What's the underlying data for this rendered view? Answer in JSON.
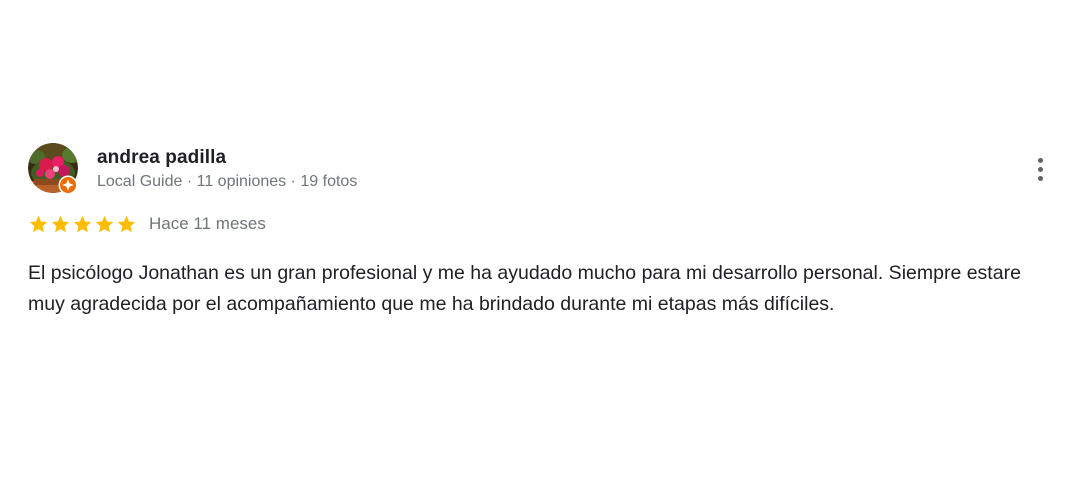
{
  "review": {
    "reviewer": {
      "name": "andrea padilla",
      "meta": "Local Guide · 11 opiniones · 19 fotos",
      "avatar_icon": "profile-photo-flowers",
      "badge_icon": "local-guide-badge-icon"
    },
    "rating": {
      "stars": 5,
      "max_stars": 5,
      "star_color": "#fbbc04",
      "date": "Hace 11 meses"
    },
    "text": "El psicólogo Jonathan es un gran profesional y me ha ayudado mucho para mi desarrollo personal. Siempre estare muy agradecida por el acompañamiento que me ha brindado durante mi etapas más difíciles.",
    "menu_icon": "more-vert-icon"
  }
}
